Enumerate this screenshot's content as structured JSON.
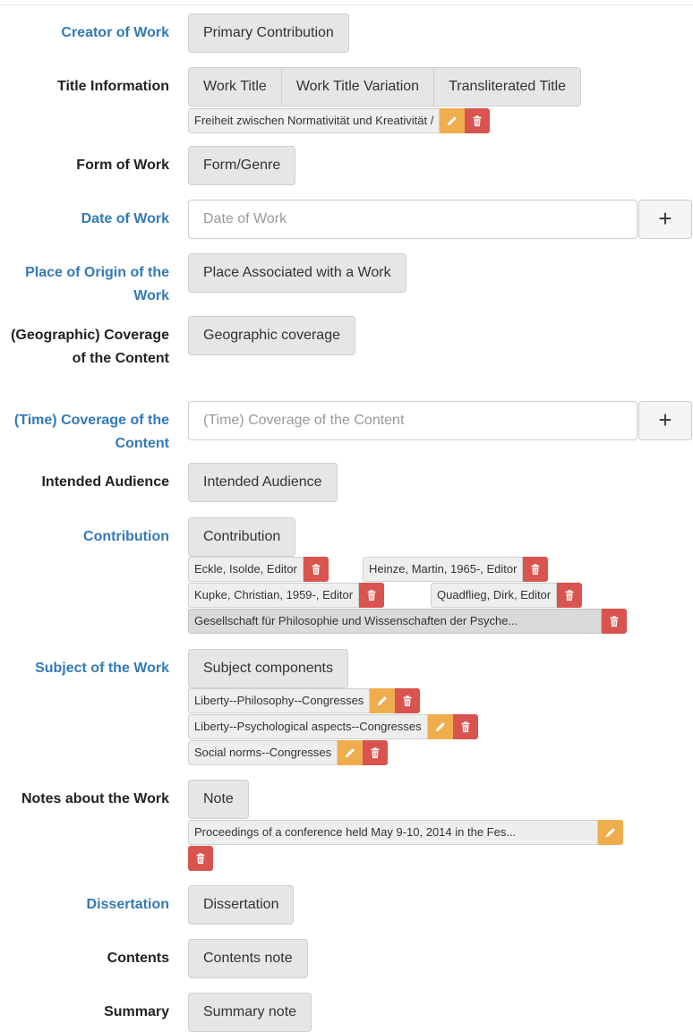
{
  "fields": {
    "creator": {
      "label": "Creator of Work",
      "button": "Primary Contribution"
    },
    "title": {
      "label": "Title Information",
      "buttons": [
        "Work Title",
        "Work Title Variation",
        "Transliterated Title"
      ],
      "tag": "Freiheit zwischen Normativität und Kreativität /"
    },
    "form": {
      "label": "Form of Work",
      "button": "Form/Genre"
    },
    "date": {
      "label": "Date of Work",
      "placeholder": "Date of Work",
      "add": "+"
    },
    "place": {
      "label": "Place of Origin of the Work",
      "button": "Place Associated with a Work"
    },
    "geo": {
      "label": "(Geographic) Coverage of the Content",
      "button": "Geographic coverage"
    },
    "time": {
      "label": "(Time) Coverage of the Content",
      "placeholder": "(Time) Coverage of the Content",
      "add": "+"
    },
    "audience": {
      "label": "Intended Audience",
      "button": "Intended Audience"
    },
    "contribution": {
      "label": "Contribution",
      "button": "Contribution",
      "tags": [
        "Eckle, Isolde, Editor",
        "Heinze, Martin, 1965-, Editor",
        "Kupke, Christian, 1959-, Editor",
        "Quadflieg, Dirk, Editor",
        "Gesellschaft für Philosophie und Wissenschaften der Psyche..."
      ]
    },
    "subject": {
      "label": "Subject of the Work",
      "button": "Subject components",
      "tags": [
        "Liberty--Philosophy--Congresses",
        "Liberty--Psychological aspects--Congresses",
        "Social norms--Congresses"
      ]
    },
    "notes": {
      "label": "Notes about the Work",
      "button": "Note",
      "tag": "Proceedings of a conference held May 9-10, 2014 in the Fes..."
    },
    "dissertation": {
      "label": "Dissertation",
      "button": "Dissertation"
    },
    "contents": {
      "label": "Contents",
      "button": "Contents note"
    },
    "summary": {
      "label": "Summary",
      "button": "Summary note"
    }
  },
  "colors": {
    "link_label": "#337ab7",
    "edit": "#f0ad4e",
    "delete": "#d9534f"
  },
  "icons": {
    "edit": "pencil-icon",
    "delete": "trash-icon"
  }
}
